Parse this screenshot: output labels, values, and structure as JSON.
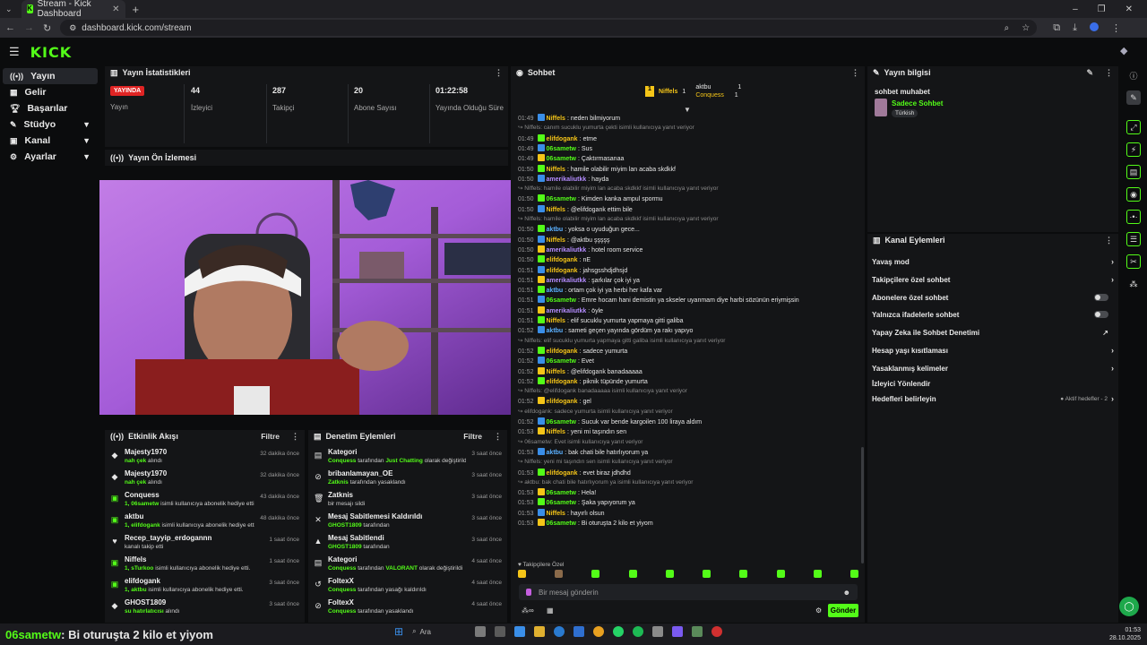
{
  "browser": {
    "tab_title": "Stream - Kick Dashboard",
    "url": "dashboard.kick.com/stream",
    "window_controls": [
      "–",
      "❐",
      "✕"
    ]
  },
  "app": {
    "logo": "KICK"
  },
  "sidebar": {
    "items": [
      {
        "label": "Yayın",
        "icon": "broadcast-icon",
        "active": true
      },
      {
        "label": "Gelir",
        "icon": "money-icon"
      },
      {
        "label": "Başarılar",
        "icon": "trophy-icon"
      },
      {
        "label": "Stüdyo",
        "icon": "studio-icon",
        "expandable": true
      },
      {
        "label": "Kanal",
        "icon": "channel-icon",
        "expandable": true
      },
      {
        "label": "Ayarlar",
        "icon": "gear-icon",
        "expandable": true
      }
    ]
  },
  "stats": {
    "title": "Yayın İstatistikleri",
    "live_badge": "YAYINDA",
    "items": [
      {
        "value": "",
        "label": "Yayın"
      },
      {
        "value": "44",
        "label": "İzleyici"
      },
      {
        "value": "287",
        "label": "Takipçi"
      },
      {
        "value": "20",
        "label": "Abone Sayısı"
      },
      {
        "value": "01:22:58",
        "label": "Yayında Olduğu Süre"
      }
    ]
  },
  "preview": {
    "title": "Yayın Ön İzlemesi"
  },
  "activity": {
    "title": "Etkinlik Akışı",
    "filter": "Filtre",
    "items": [
      {
        "name": "Majesty1970",
        "sub_hl": "nah çek",
        "sub": " alındı",
        "time": "32 dakika önce",
        "icon": "◆"
      },
      {
        "name": "Majesty1970",
        "sub_hl": "nah çek",
        "sub": " alındı",
        "time": "32 dakika önce",
        "icon": "◆"
      },
      {
        "name": "Conquess",
        "sub_hl": "1, 06sametw",
        "sub": " isimli kullanıcıya abonelik hediye etti.",
        "time": "43 dakika önce",
        "icon": "▣"
      },
      {
        "name": "aktbu",
        "sub_hl": "1, elifdogank",
        "sub": " isimli kullanıcıya abonelik hediye etti.",
        "time": "48 dakika önce",
        "icon": "▣"
      },
      {
        "name": "Recep_tayyip_erdogannn",
        "sub_hl": "",
        "sub": "kanalı takip etti",
        "time": "1 saat önce",
        "icon": "♥"
      },
      {
        "name": "Niffels",
        "sub_hl": "1, sTurkoo",
        "sub": " isimli kullanıcıya abonelik hediye etti.",
        "time": "1 saat önce",
        "icon": "▣"
      },
      {
        "name": "elifdogank",
        "sub_hl": "1, aktbu",
        "sub": " isimli kullanıcıya abonelik hediye etti.",
        "time": "3 saat önce",
        "icon": "▣"
      },
      {
        "name": "GHOST1809",
        "sub_hl": "su hatırlatıcısı",
        "sub": " alındı",
        "time": "3 saat önce",
        "icon": "◆"
      }
    ]
  },
  "modactions": {
    "title": "Denetim Eylemleri",
    "filter": "Filtre",
    "items": [
      {
        "name": "Kategori",
        "sub_hl": "Conquess",
        "sub": " tarafından ",
        "sub_hl2": "Just Chatting",
        "sub2": " olarak değiştirildi",
        "time": "3 saat önce",
        "icon": "▤"
      },
      {
        "name": "bribanlamayan_OE",
        "sub_hl": "Zatknis",
        "sub": " tarafından yasaklandı",
        "sub_hl2": "",
        "sub2": "",
        "time": "3 saat önce",
        "icon": "⊘"
      },
      {
        "name": "Zatknis",
        "sub_hl": "",
        "sub": "bir mesajı sildi",
        "sub_hl2": "",
        "sub2": "",
        "time": "3 saat önce",
        "icon": "🗑"
      },
      {
        "name": "Mesaj Sabitlemesi Kaldırıldı",
        "sub_hl": "GHOST1809",
        "sub": " tarafından",
        "sub_hl2": "",
        "sub2": "",
        "time": "3 saat önce",
        "icon": "✕"
      },
      {
        "name": "Mesaj Sabitlendi",
        "sub_hl": "GHOST1809",
        "sub": " tarafından",
        "sub_hl2": "",
        "sub2": "",
        "time": "3 saat önce",
        "icon": "▲"
      },
      {
        "name": "Kategori",
        "sub_hl": "Conquess",
        "sub": " tarafından ",
        "sub_hl2": "VALORANT",
        "sub2": " olarak değiştirildi",
        "time": "4 saat önce",
        "icon": "▤"
      },
      {
        "name": "FoltexX",
        "sub_hl": "Conquess",
        "sub": " tarafından yasağı kaldırıldı",
        "sub_hl2": "",
        "sub2": "",
        "time": "4 saat önce",
        "icon": "↺"
      },
      {
        "name": "FoltexX",
        "sub_hl": "Conquess",
        "sub": " tarafından yasaklandı",
        "sub_hl2": "",
        "sub2": "",
        "time": "4 saat önce",
        "icon": "⊘"
      }
    ]
  },
  "chat": {
    "title": "Sohbet",
    "leaderboard": [
      {
        "name": "Niffels",
        "count": "1",
        "color": "#f5c518"
      },
      {
        "name": "aktbu",
        "count": "1",
        "color": "#e6e6e6"
      },
      {
        "name": "Conquess",
        "count": "1",
        "color": "#f5c518"
      }
    ],
    "messages": [
      {
        "time": "01:49",
        "user": "Niffels",
        "color": "#f5c518",
        "text": "neden bilmiyorum",
        "reply": false
      },
      {
        "time": "",
        "user": "",
        "color": "",
        "text": "↪ Niffels: canım sucuklu yumurta çekti isimli kullanıcıya yanıt veriyor",
        "reply": true
      },
      {
        "time": "01:49",
        "user": "elifdogank",
        "color": "#f5c518",
        "text": "etme",
        "reply": false
      },
      {
        "time": "01:49",
        "user": "06sametw",
        "color": "#53fc18",
        "text": "Sus",
        "reply": false
      },
      {
        "time": "01:49",
        "user": "06sametw",
        "color": "#53fc18",
        "text": "Çaktırmasanaa",
        "reply": false
      },
      {
        "time": "01:50",
        "user": "Niffels",
        "color": "#f5c518",
        "text": "hamile olabilir miyim lan acaba skdkkf",
        "reply": false
      },
      {
        "time": "01:50",
        "user": "amerikaliutkk",
        "color": "#b48cff",
        "text": "hayda",
        "reply": false
      },
      {
        "time": "",
        "user": "",
        "color": "",
        "text": "↪ Niffels: hamile olabilir miyim lan acaba skdkkf isimli kullanıcıya yanıt veriyor",
        "reply": true
      },
      {
        "time": "01:50",
        "user": "06sametw",
        "color": "#53fc18",
        "text": "Kimden kanka ampul spormu",
        "reply": false
      },
      {
        "time": "01:50",
        "user": "Niffels",
        "color": "#f5c518",
        "text": "@elifdogank ettim bile",
        "reply": false
      },
      {
        "time": "",
        "user": "",
        "color": "",
        "text": "↪ Niffels: hamile olabilir miyim lan acaba skdkkf isimli kullanıcıya yanıt veriyor",
        "reply": true
      },
      {
        "time": "01:50",
        "user": "aktbu",
        "color": "#5ab0ff",
        "text": "yoksa o uyuduğun gece...",
        "reply": false
      },
      {
        "time": "01:50",
        "user": "Niffels",
        "color": "#f5c518",
        "text": "@aktbu şşşşş",
        "reply": false
      },
      {
        "time": "01:50",
        "user": "amerikaliutkk",
        "color": "#b48cff",
        "text": "hotel room service",
        "reply": false
      },
      {
        "time": "01:50",
        "user": "elifdogank",
        "color": "#f5c518",
        "text": "nE",
        "reply": false
      },
      {
        "time": "01:51",
        "user": "elifdogank",
        "color": "#f5c518",
        "text": "jahsgsshdjdhsjd",
        "reply": false
      },
      {
        "time": "01:51",
        "user": "amerikaliutkk",
        "color": "#b48cff",
        "text": "şarkılar çok iyi ya",
        "reply": false
      },
      {
        "time": "01:51",
        "user": "aktbu",
        "color": "#5ab0ff",
        "text": "ortam çok iyi ya herbi her kafa var",
        "reply": false
      },
      {
        "time": "01:51",
        "user": "06sametw",
        "color": "#53fc18",
        "text": "Emre hocam hani demistin ya skseler uyanmam diye harbi sözünün eriymişsin",
        "reply": false
      },
      {
        "time": "01:51",
        "user": "amerikaliutkk",
        "color": "#b48cff",
        "text": "öyle",
        "reply": false
      },
      {
        "time": "01:51",
        "user": "Niffels",
        "color": "#f5c518",
        "text": "elif sucuklu yumurta yapmaya gitti galiba",
        "reply": false
      },
      {
        "time": "01:52",
        "user": "aktbu",
        "color": "#5ab0ff",
        "text": "sameti geçen yayında gördüm ya rakı yapıyo",
        "reply": false
      },
      {
        "time": "",
        "user": "",
        "color": "",
        "text": "↪ Niffels: elif sucuklu yumurta yapmaya gitti galiba isimli kullanıcıya yanıt veriyor",
        "reply": true
      },
      {
        "time": "01:52",
        "user": "elifdogank",
        "color": "#f5c518",
        "text": "sadece yumurta",
        "reply": false
      },
      {
        "time": "01:52",
        "user": "06sametw",
        "color": "#53fc18",
        "text": "Evet",
        "reply": false
      },
      {
        "time": "01:52",
        "user": "Niffels",
        "color": "#f5c518",
        "text": "@elifdogank banadaaaaa",
        "reply": false
      },
      {
        "time": "01:52",
        "user": "elifdogank",
        "color": "#f5c518",
        "text": "piknik tüpünde yumurta",
        "reply": false
      },
      {
        "time": "",
        "user": "",
        "color": "",
        "text": "↪ Niffels: @elifdogank banadaaaaa isimli kullanıcıya yanıt veriyor",
        "reply": true
      },
      {
        "time": "01:52",
        "user": "elifdogank",
        "color": "#f5c518",
        "text": "gel",
        "reply": false
      },
      {
        "time": "",
        "user": "",
        "color": "",
        "text": "↪ elifdogank: sadece yumurta isimli kullanıcıya yanıt veriyor",
        "reply": true
      },
      {
        "time": "01:52",
        "user": "06sametw",
        "color": "#53fc18",
        "text": "Sucuk var bende kargoilen 100 liraya aldım",
        "reply": false
      },
      {
        "time": "01:53",
        "user": "Niffels",
        "color": "#f5c518",
        "text": "yeni mi taşındın sen",
        "reply": false
      },
      {
        "time": "",
        "user": "",
        "color": "",
        "text": "↪ 06sametw: Evet isimli kullanıcıya yanıt veriyor",
        "reply": true
      },
      {
        "time": "01:53",
        "user": "aktbu",
        "color": "#5ab0ff",
        "text": "bak chati bile hatırlıyorum ya",
        "reply": false
      },
      {
        "time": "",
        "user": "",
        "color": "",
        "text": "↪ Niffels: yeni mi taşındın sen isimli kullanıcıya yanıt veriyor",
        "reply": true
      },
      {
        "time": "01:53",
        "user": "elifdogank",
        "color": "#f5c518",
        "text": "evet biraz jdhdhd",
        "reply": false
      },
      {
        "time": "",
        "user": "",
        "color": "",
        "text": "↪ aktbu: bak chati bile hatırlıyorum ya isimli kullanıcıya yanıt veriyor",
        "reply": true
      },
      {
        "time": "01:53",
        "user": "06sametw",
        "color": "#53fc18",
        "text": "Hela!",
        "reply": false
      },
      {
        "time": "01:53",
        "user": "06sametw",
        "color": "#53fc18",
        "text": "Şaka yapıyorum ya",
        "reply": false
      },
      {
        "time": "01:53",
        "user": "Niffels",
        "color": "#f5c518",
        "text": "hayırlı olsun",
        "reply": false
      },
      {
        "time": "01:53",
        "user": "06sametw",
        "color": "#53fc18",
        "text": "Bi oturuşta 2 kilo et yiyom",
        "reply": false
      }
    ],
    "followers_only": "♥ Takipçilere Özel",
    "input_placeholder": "Bir mesaj gönderin",
    "send_label": "Gönder"
  },
  "stream_info": {
    "title": "Yayın bilgisi",
    "stream_title": "sohbet muhabet",
    "category": "Sadece Sohbet",
    "language": "Türkish"
  },
  "channel_actions": {
    "title": "Kanal Eylemleri",
    "items": [
      {
        "label": "Yavaş mod",
        "control": "arrow"
      },
      {
        "label": "Takipçilere özel sohbet",
        "control": "arrow"
      },
      {
        "label": "Abonelere özel sohbet",
        "control": "toggle"
      },
      {
        "label": "Yalnızca ifadelerle sohbet",
        "control": "toggle"
      },
      {
        "label": "Yapay Zeka ile Sohbet Denetimi",
        "control": "external"
      },
      {
        "label": "Hesap yaşı kısıtlaması",
        "control": "arrow"
      },
      {
        "label": "Yasaklanmış kelimeler",
        "control": "arrow"
      },
      {
        "label": "İzleyici Yönlendir",
        "control": "none"
      },
      {
        "label": "Hedefleri belirleyin",
        "control": "goal"
      }
    ],
    "goal_status": "● Aktif hedefler - 2"
  },
  "overlay": {
    "user": "06sametw",
    "text": ": Bi oturuşta 2 kilo et yiyom"
  },
  "taskbar": {
    "search": "Ara",
    "time": "01:53",
    "date": "28.10.2025"
  },
  "colors": {
    "accent": "#53fc18",
    "live": "#e02424",
    "gold": "#f5c518"
  }
}
